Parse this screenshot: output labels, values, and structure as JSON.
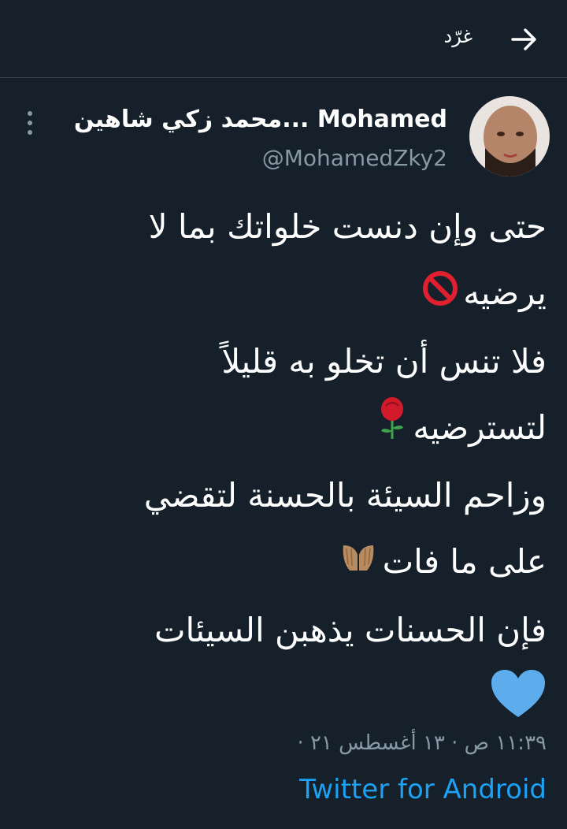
{
  "header": {
    "title": "غرّد",
    "back_icon": "arrow-right-icon"
  },
  "author": {
    "display_name": "محمد زكي شاهين... Mohamed",
    "handle": "@MohamedZky2",
    "avatar_icon": "avatar"
  },
  "tweet": {
    "lines": [
      "حتى وإن دنست خلواتك بما لا",
      "يرضيه",
      "فلا تنس أن تخلو به قليلاً",
      "لتسترضيه",
      "وزاحم السيئة بالحسنة لتقضي",
      "على ما فات",
      "فإن الحسنات يذهبن السيئات"
    ],
    "emoji": {
      "line2": "prohibited-icon",
      "line4": "rose-icon",
      "line6": "praying-hands-icon",
      "final": "blue-heart-icon"
    }
  },
  "meta": {
    "timestamp": "١١:٣٩ ص · ١٣ أغسطس ٢١ ·",
    "source": "Twitter for Android"
  },
  "colors": {
    "background": "#15202b",
    "secondary_text": "#8899a6",
    "link": "#1da1f2",
    "heart": "#5dadec"
  }
}
